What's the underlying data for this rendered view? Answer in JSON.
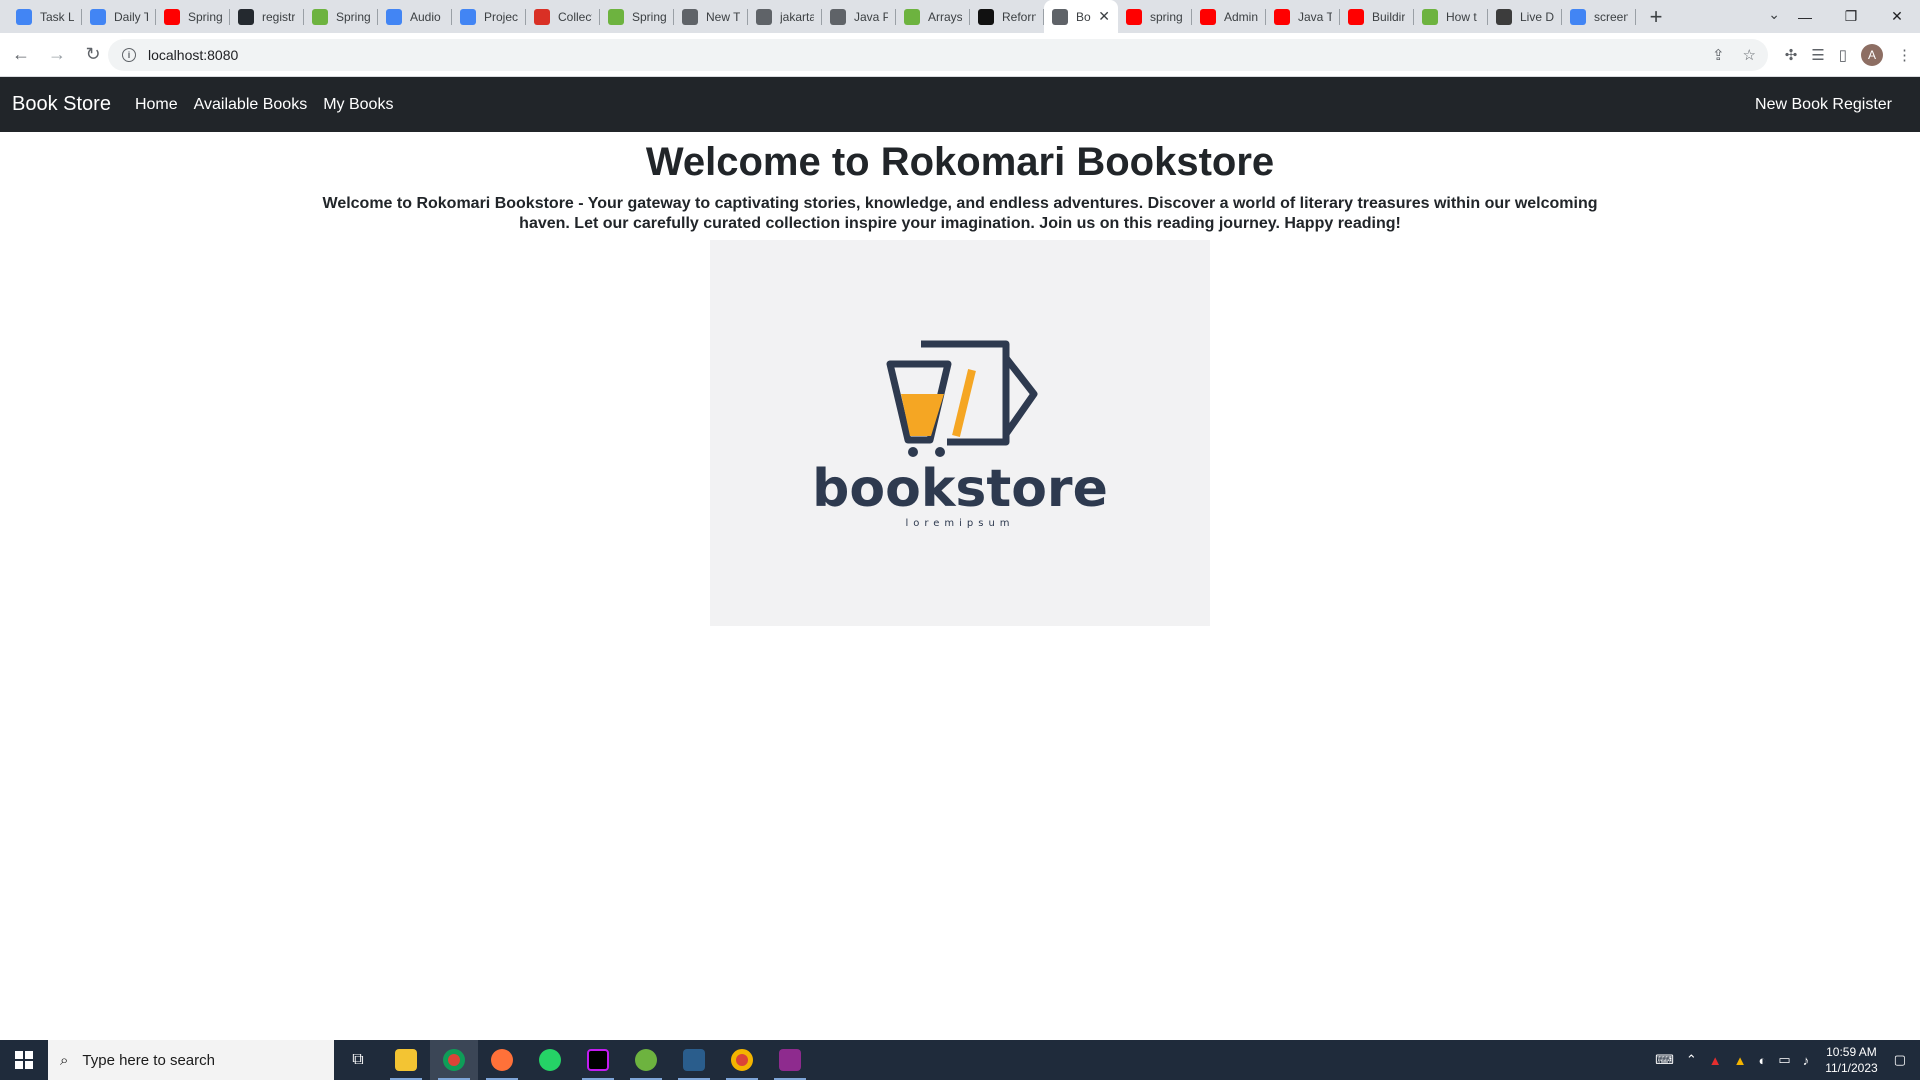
{
  "browser": {
    "tabs": [
      {
        "title": "Task Li",
        "color": "#4285f4"
      },
      {
        "title": "Daily T",
        "color": "#4285f4"
      },
      {
        "title": "Spring",
        "color": "#ff0000"
      },
      {
        "title": "registr",
        "color": "#24292f"
      },
      {
        "title": "Spring",
        "color": "#6db33f"
      },
      {
        "title": "Audio",
        "color": "#4285f4"
      },
      {
        "title": "Projec",
        "color": "#4285f4"
      },
      {
        "title": "Collect",
        "color": "#d93025"
      },
      {
        "title": "Spring",
        "color": "#6db33f"
      },
      {
        "title": "New T",
        "color": "#5f6368"
      },
      {
        "title": "jakarta",
        "color": "#5f6368"
      },
      {
        "title": "Java Pi",
        "color": "#5f6368"
      },
      {
        "title": "Arrays",
        "color": "#6db33f"
      },
      {
        "title": "Reforn",
        "color": "#111111"
      },
      {
        "title": "Bo",
        "color": "#5f6368",
        "active": true
      },
      {
        "title": "spring",
        "color": "#ff0000"
      },
      {
        "title": "Admin",
        "color": "#ff0000"
      },
      {
        "title": "Java T",
        "color": "#ff0000"
      },
      {
        "title": "Buildir",
        "color": "#ff0000"
      },
      {
        "title": "How t",
        "color": "#6db33f"
      },
      {
        "title": "Live D",
        "color": "#3c3c3c"
      },
      {
        "title": "screen",
        "color": "#4285f4"
      }
    ],
    "url": "localhost:8080",
    "profile_initial": "A"
  },
  "navbar": {
    "brand": "Book Store",
    "links": [
      "Home",
      "Available Books",
      "My Books"
    ],
    "right_link": "New Book Register"
  },
  "main": {
    "heading": "Welcome to Rokomari Bookstore",
    "lead": "Welcome to Rokomari Bookstore - Your gateway to captivating stories, knowledge, and endless adventures. Discover a world of literary treasures within our welcoming haven. Let our carefully curated collection inspire your imagination. Join us on this reading journey. Happy reading!",
    "logo": {
      "wordmark": "bookstore",
      "tagline": "loremipsum",
      "colors": {
        "dark": "#2e3a4f",
        "accent": "#f5a623"
      }
    }
  },
  "taskbar": {
    "search_placeholder": "Type here to search",
    "time": "10:59 AM",
    "date": "11/1/2023"
  }
}
